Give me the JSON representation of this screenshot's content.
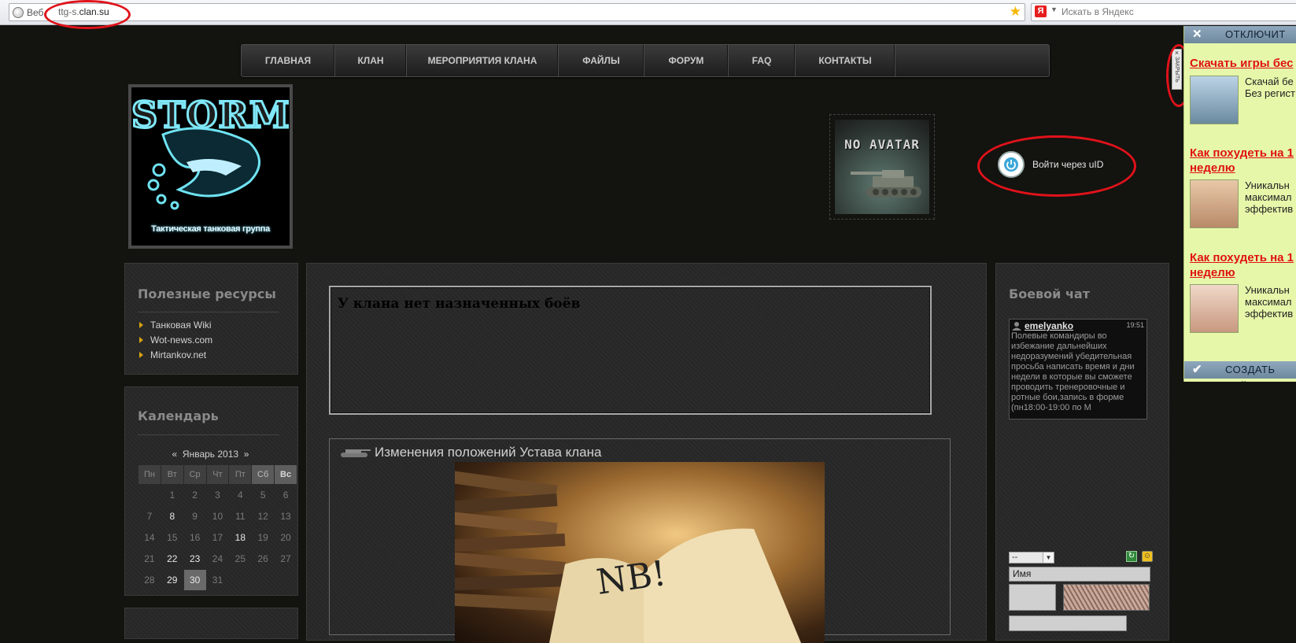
{
  "browser": {
    "site_badge": "Веб",
    "url_prefix": "ttg-s.",
    "url_domain": "clan.su",
    "search_placeholder": "Искать в Яндекс",
    "yandex_logo": "Я"
  },
  "nav": [
    "ГЛАВНАЯ",
    "КЛАН",
    "МЕРОПРИЯТИЯ КЛАНА",
    "ФАЙЛЫ",
    "ФОРУМ",
    "FAQ",
    "КОНТАКТЫ"
  ],
  "header": {
    "logo_text": "STORM",
    "logo_subtitle": "Тактическая танковая группа",
    "avatar_text": "NO AVATAR",
    "login_label": "Войти через uID"
  },
  "resources": {
    "title": "Полезные ресурсы",
    "links": [
      "Танковая Wiki",
      "Wot-news.com",
      "Mirtankov.net"
    ]
  },
  "calendar": {
    "title": "Календарь",
    "prev": "«",
    "month": "Январь 2013",
    "next": "»",
    "weekdays": [
      "Пн",
      "Вт",
      "Ср",
      "Чт",
      "Пт",
      "Сб",
      "Вс"
    ],
    "weeks": [
      [
        "",
        "1",
        "2",
        "3",
        "4",
        "5",
        "6"
      ],
      [
        "7",
        "8",
        "9",
        "10",
        "11",
        "12",
        "13"
      ],
      [
        "14",
        "15",
        "16",
        "17",
        "18",
        "19",
        "20"
      ],
      [
        "21",
        "22",
        "23",
        "24",
        "25",
        "26",
        "27"
      ],
      [
        "28",
        "29",
        "30",
        "31",
        "",
        "",
        ""
      ]
    ],
    "highlighted_days": [
      "8",
      "18",
      "22",
      "23",
      "29"
    ],
    "today": "30"
  },
  "main": {
    "battles_text": "У клана нет назначенных боёв",
    "news_title": "Изменения положений Устава клана",
    "news_image_text": "NB!"
  },
  "chat": {
    "title": "Боевой чат",
    "user": "emelyanko",
    "time": "19:51",
    "message": "Полевые командиры во избежание дальнейших недоразумений убедительная просьба написать время и дни недели в которые вы сможете проводить тренеровочные и ротные бои,запись в форме (пн18:00-19:00 по М",
    "select_value": "--",
    "name_placeholder": "Имя"
  },
  "ads": {
    "top_label": "ОТКЛЮЧИТ",
    "bottom_label": "СОЗДАТЬ САЙТ",
    "close_tab_text": "ЗАКРЫТЬ",
    "items": [
      {
        "title": "Скачать игры бес",
        "desc1": "Скачай бе",
        "desc2": "Без регист"
      },
      {
        "title": "Как похудеть на 1",
        "title2": "неделю",
        "desc1": "Уникальн",
        "desc2": "максимал",
        "desc3": "эффектив"
      },
      {
        "title": "Как похудеть на 1",
        "title2": "неделю",
        "desc1": "Уникальн",
        "desc2": "максимал",
        "desc3": "эффектив"
      }
    ]
  },
  "colors": {
    "annotation": "#e0121a",
    "page_bg": "#13130f",
    "ad_bg": "#e6f7aa",
    "ad_title": "#e01212",
    "accent_triangle": "#d7a312"
  }
}
